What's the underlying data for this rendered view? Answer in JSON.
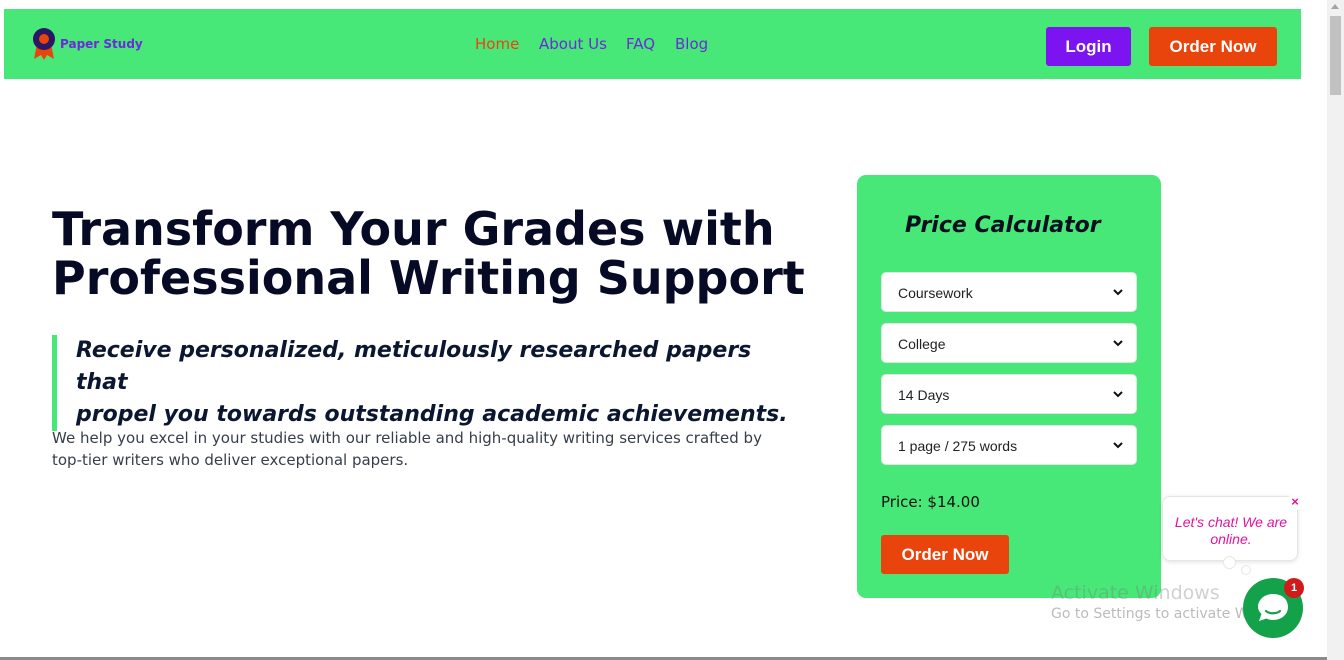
{
  "header": {
    "brand": "Paper Study",
    "nav": [
      {
        "label": "Home",
        "active": true
      },
      {
        "label": "About Us",
        "active": false
      },
      {
        "label": "FAQ",
        "active": false
      },
      {
        "label": "Blog",
        "active": false
      }
    ],
    "login_label": "Login",
    "order_label": "Order Now"
  },
  "hero": {
    "title_line1": "Transform Your Grades with",
    "title_line2": "Professional Writing Support",
    "quote_line1": "Receive personalized, meticulously researched papers that",
    "quote_line2": "propel you towards outstanding academic achievements.",
    "description_line1": "We help you excel in your studies with our reliable and high-quality writing services crafted by",
    "description_line2": "top-tier writers who deliver exceptional papers."
  },
  "calculator": {
    "title": "Price Calculator",
    "selects": [
      {
        "name": "paper-type",
        "value": "Coursework"
      },
      {
        "name": "academic-level",
        "value": "College"
      },
      {
        "name": "deadline",
        "value": "14 Days"
      },
      {
        "name": "pages",
        "value": "1 page / 275 words"
      }
    ],
    "price": "Price: $14.00",
    "order_label": "Order Now"
  },
  "chat": {
    "message_line1": "Let's chat! We are",
    "message_line2": "online.",
    "close_glyph": "×",
    "badge_count": "1"
  },
  "watermark": {
    "title": "Activate Windows",
    "subtitle": "Go to Settings to activate Windows."
  },
  "colors": {
    "brand_green": "#48e878",
    "accent_orange": "#e8440c",
    "accent_purple": "#7b14f0",
    "link_purple": "#6a2bd9",
    "chat_green": "#13a24a",
    "chat_pink": "#e0149e"
  }
}
